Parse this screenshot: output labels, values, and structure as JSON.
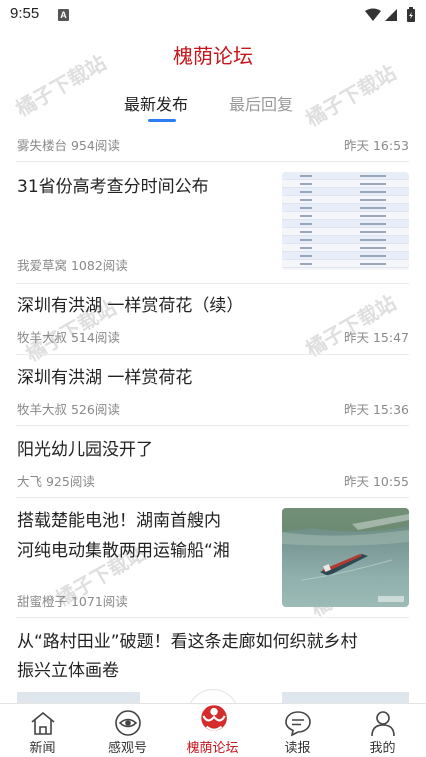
{
  "status_bar": {
    "time": "9:55",
    "notification_letter": "A"
  },
  "app": {
    "title": "槐荫论坛"
  },
  "tabs": [
    {
      "label": "最新发布",
      "active": true
    },
    {
      "label": "最后回复",
      "active": false
    }
  ],
  "watermark": "橘子下载站",
  "posts": [
    {
      "title": "",
      "meta": "雾失楼台 954阅读",
      "time": "昨天 16:53"
    },
    {
      "title": "31省份高考查分时间公布",
      "meta": "我爱草窝 1082阅读",
      "time": "",
      "thumbnail": "score-table-image"
    },
    {
      "title": "深圳有洪湖 一样赏荷花（续）",
      "meta": "牧羊大叔 514阅读",
      "time": "昨天 15:47"
    },
    {
      "title": "深圳有洪湖 一样赏荷花",
      "meta": "牧羊大叔 526阅读",
      "time": "昨天 15:36"
    },
    {
      "title": "阳光幼儿园没开了",
      "meta": "大飞 925阅读",
      "time": "昨天 10:55"
    },
    {
      "title_line1": "搭载楚能电池！湖南首艘内",
      "title_line2": "河纯电动集散两用运输船“湘",
      "meta": "甜蜜橙子 1071阅读",
      "time": "",
      "thumbnail": "cargo-ship-image"
    },
    {
      "title_line1": "从“路村田业”破题！看这条走廊如何织就乡村",
      "title_line2": "振兴立体画卷",
      "meta": "",
      "time": ""
    }
  ],
  "bottom_nav": [
    {
      "label": "新闻",
      "icon": "home-icon",
      "active": false
    },
    {
      "label": "感观号",
      "icon": "eye-icon",
      "active": false
    },
    {
      "label": "槐荫论坛",
      "icon": "forum-logo-icon",
      "active": true
    },
    {
      "label": "读报",
      "icon": "chat-bubble-icon",
      "active": false
    },
    {
      "label": "我的",
      "icon": "user-icon",
      "active": false
    }
  ],
  "colors": {
    "brand_red": "#c8161d",
    "tab_indicator_blue": "#2c7ef0",
    "meta_gray": "#8a8a8a"
  }
}
